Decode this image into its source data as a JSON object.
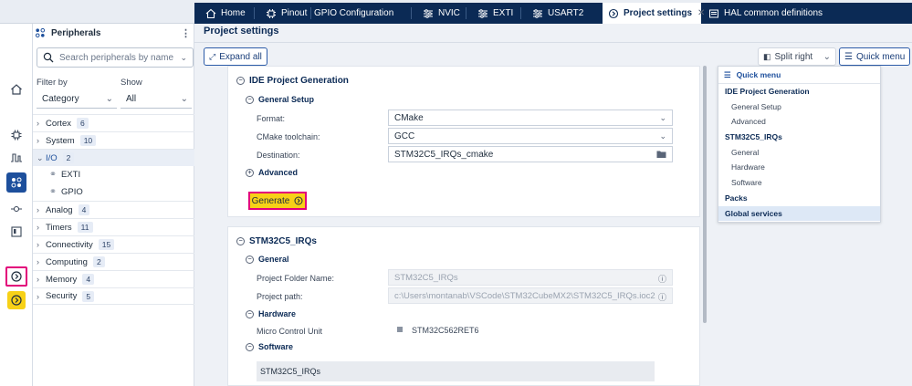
{
  "tabs": [
    {
      "label": "Home",
      "icon": "home-icon"
    },
    {
      "label": "Pinout",
      "icon": "chip-icon"
    },
    {
      "label": "GPIO Configuration",
      "icon": ""
    },
    {
      "label": "NVIC",
      "icon": "settings-icon"
    },
    {
      "label": "EXTI",
      "icon": "settings-icon"
    },
    {
      "label": "USART2",
      "icon": "settings-icon"
    },
    {
      "label": "Project settings",
      "icon": "project-icon"
    },
    {
      "label": "HAL common definitions",
      "icon": "doc-icon"
    }
  ],
  "peripherals": {
    "title": "Peripherals",
    "search_placeholder": "Search peripherals by name",
    "filter_by_label": "Filter by",
    "filter_by_value": "Category",
    "show_label": "Show",
    "show_value": "All",
    "items": [
      {
        "label": "Cortex",
        "count": "6"
      },
      {
        "label": "System",
        "count": "10"
      },
      {
        "label": "I/O",
        "count": "2"
      },
      {
        "label": "Analog",
        "count": "4"
      },
      {
        "label": "Timers",
        "count": "11"
      },
      {
        "label": "Connectivity",
        "count": "15"
      },
      {
        "label": "Computing",
        "count": "2"
      },
      {
        "label": "Memory",
        "count": "4"
      },
      {
        "label": "Security",
        "count": "5"
      }
    ],
    "io_children": [
      "EXTI",
      "GPIO"
    ]
  },
  "main": {
    "title": "Project settings",
    "expand_all": "Expand all",
    "split_right": "Split right",
    "quick_menu_button": "Quick menu"
  },
  "ide": {
    "title": "IDE Project Generation",
    "general_setup": "General Setup",
    "format_label": "Format:",
    "format_value": "CMake",
    "toolchain_label": "CMake toolchain:",
    "toolchain_value": "GCC",
    "destination_label": "Destination:",
    "destination_value": "STM32C5_IRQs_cmake",
    "advanced": "Advanced",
    "generate": "Generate"
  },
  "project": {
    "title": "STM32C5_IRQs",
    "general": "General",
    "folder_label": "Project Folder Name:",
    "folder_value": "STM32C5_IRQs",
    "path_label": "Project path:",
    "path_value": "c:\\Users\\montanab\\VSCode\\STM32CubeMX2\\STM32C5_IRQs.ioc2",
    "hardware": "Hardware",
    "mcu_label": "Micro Control Unit",
    "mcu_value": "STM32C562RET6",
    "software": "Software",
    "software_value": "STM32C5_IRQs"
  },
  "quick_menu": {
    "title": "Quick menu",
    "items": [
      {
        "label": "IDE Project Generation",
        "level": "group"
      },
      {
        "label": "General Setup",
        "level": "item"
      },
      {
        "label": "Advanced",
        "level": "item"
      },
      {
        "label": "STM32C5_IRQs",
        "level": "group"
      },
      {
        "label": "General",
        "level": "item"
      },
      {
        "label": "Hardware",
        "level": "item"
      },
      {
        "label": "Software",
        "level": "item"
      },
      {
        "label": "Packs",
        "level": "group"
      },
      {
        "label": "Global services",
        "level": "group"
      }
    ]
  },
  "colors": {
    "navy": "#0b2a55",
    "highlight_border": "#e2007a",
    "generate_yellow": "#f7d117",
    "accent_blue": "#2d5ca8"
  }
}
